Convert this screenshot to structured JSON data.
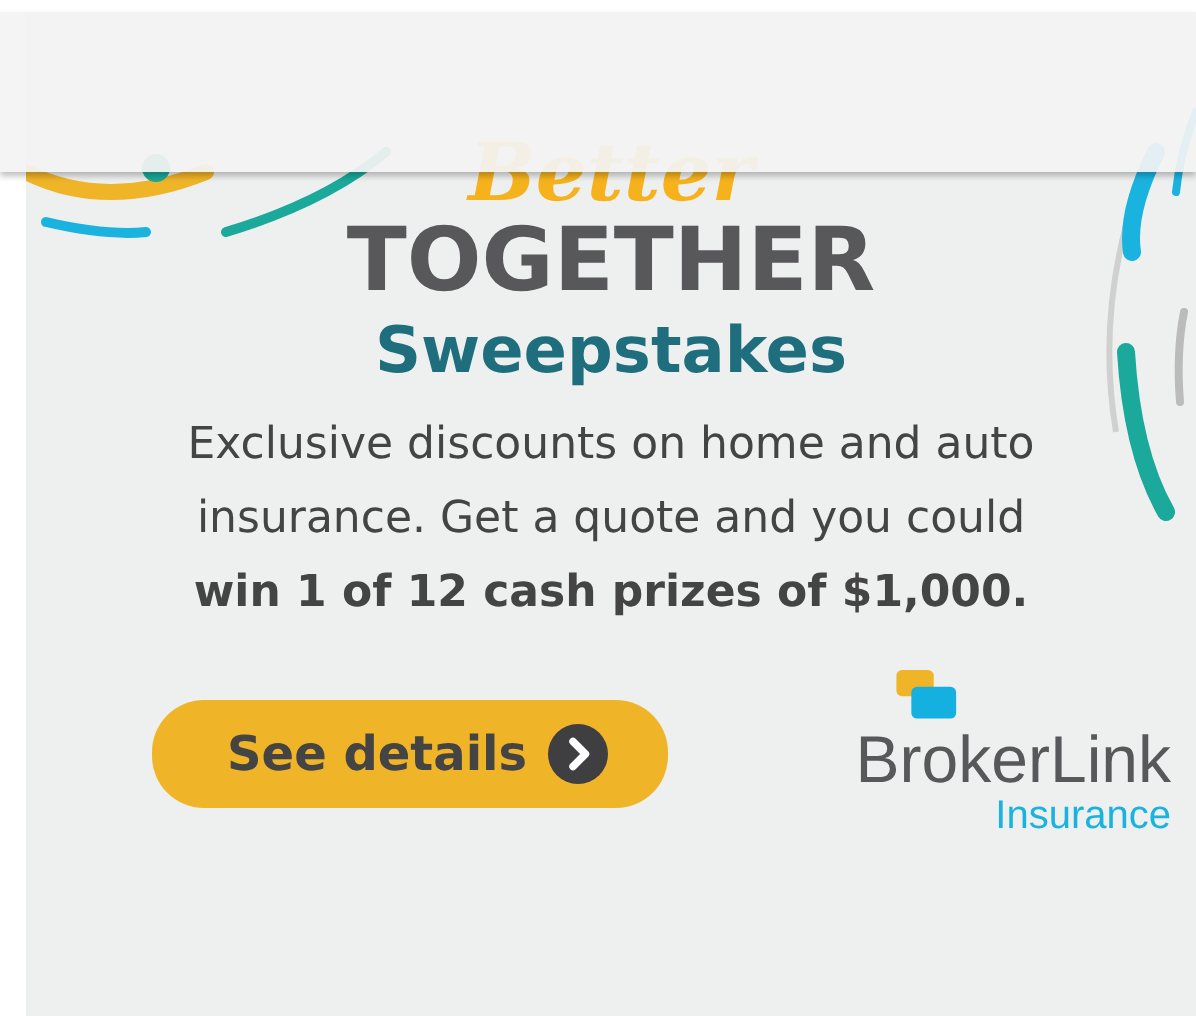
{
  "ad": {
    "script_title": "Better",
    "headline": "TOGETHER",
    "subheadline": "Sweepstakes",
    "body": "Exclusive discounts on home and auto insurance. Get a quote and you could **win 1 of 12 cash prizes of $1,000.**",
    "button": "See details",
    "logo": {
      "name": "BrokerLink",
      "tagline": "Insurance"
    }
  }
}
